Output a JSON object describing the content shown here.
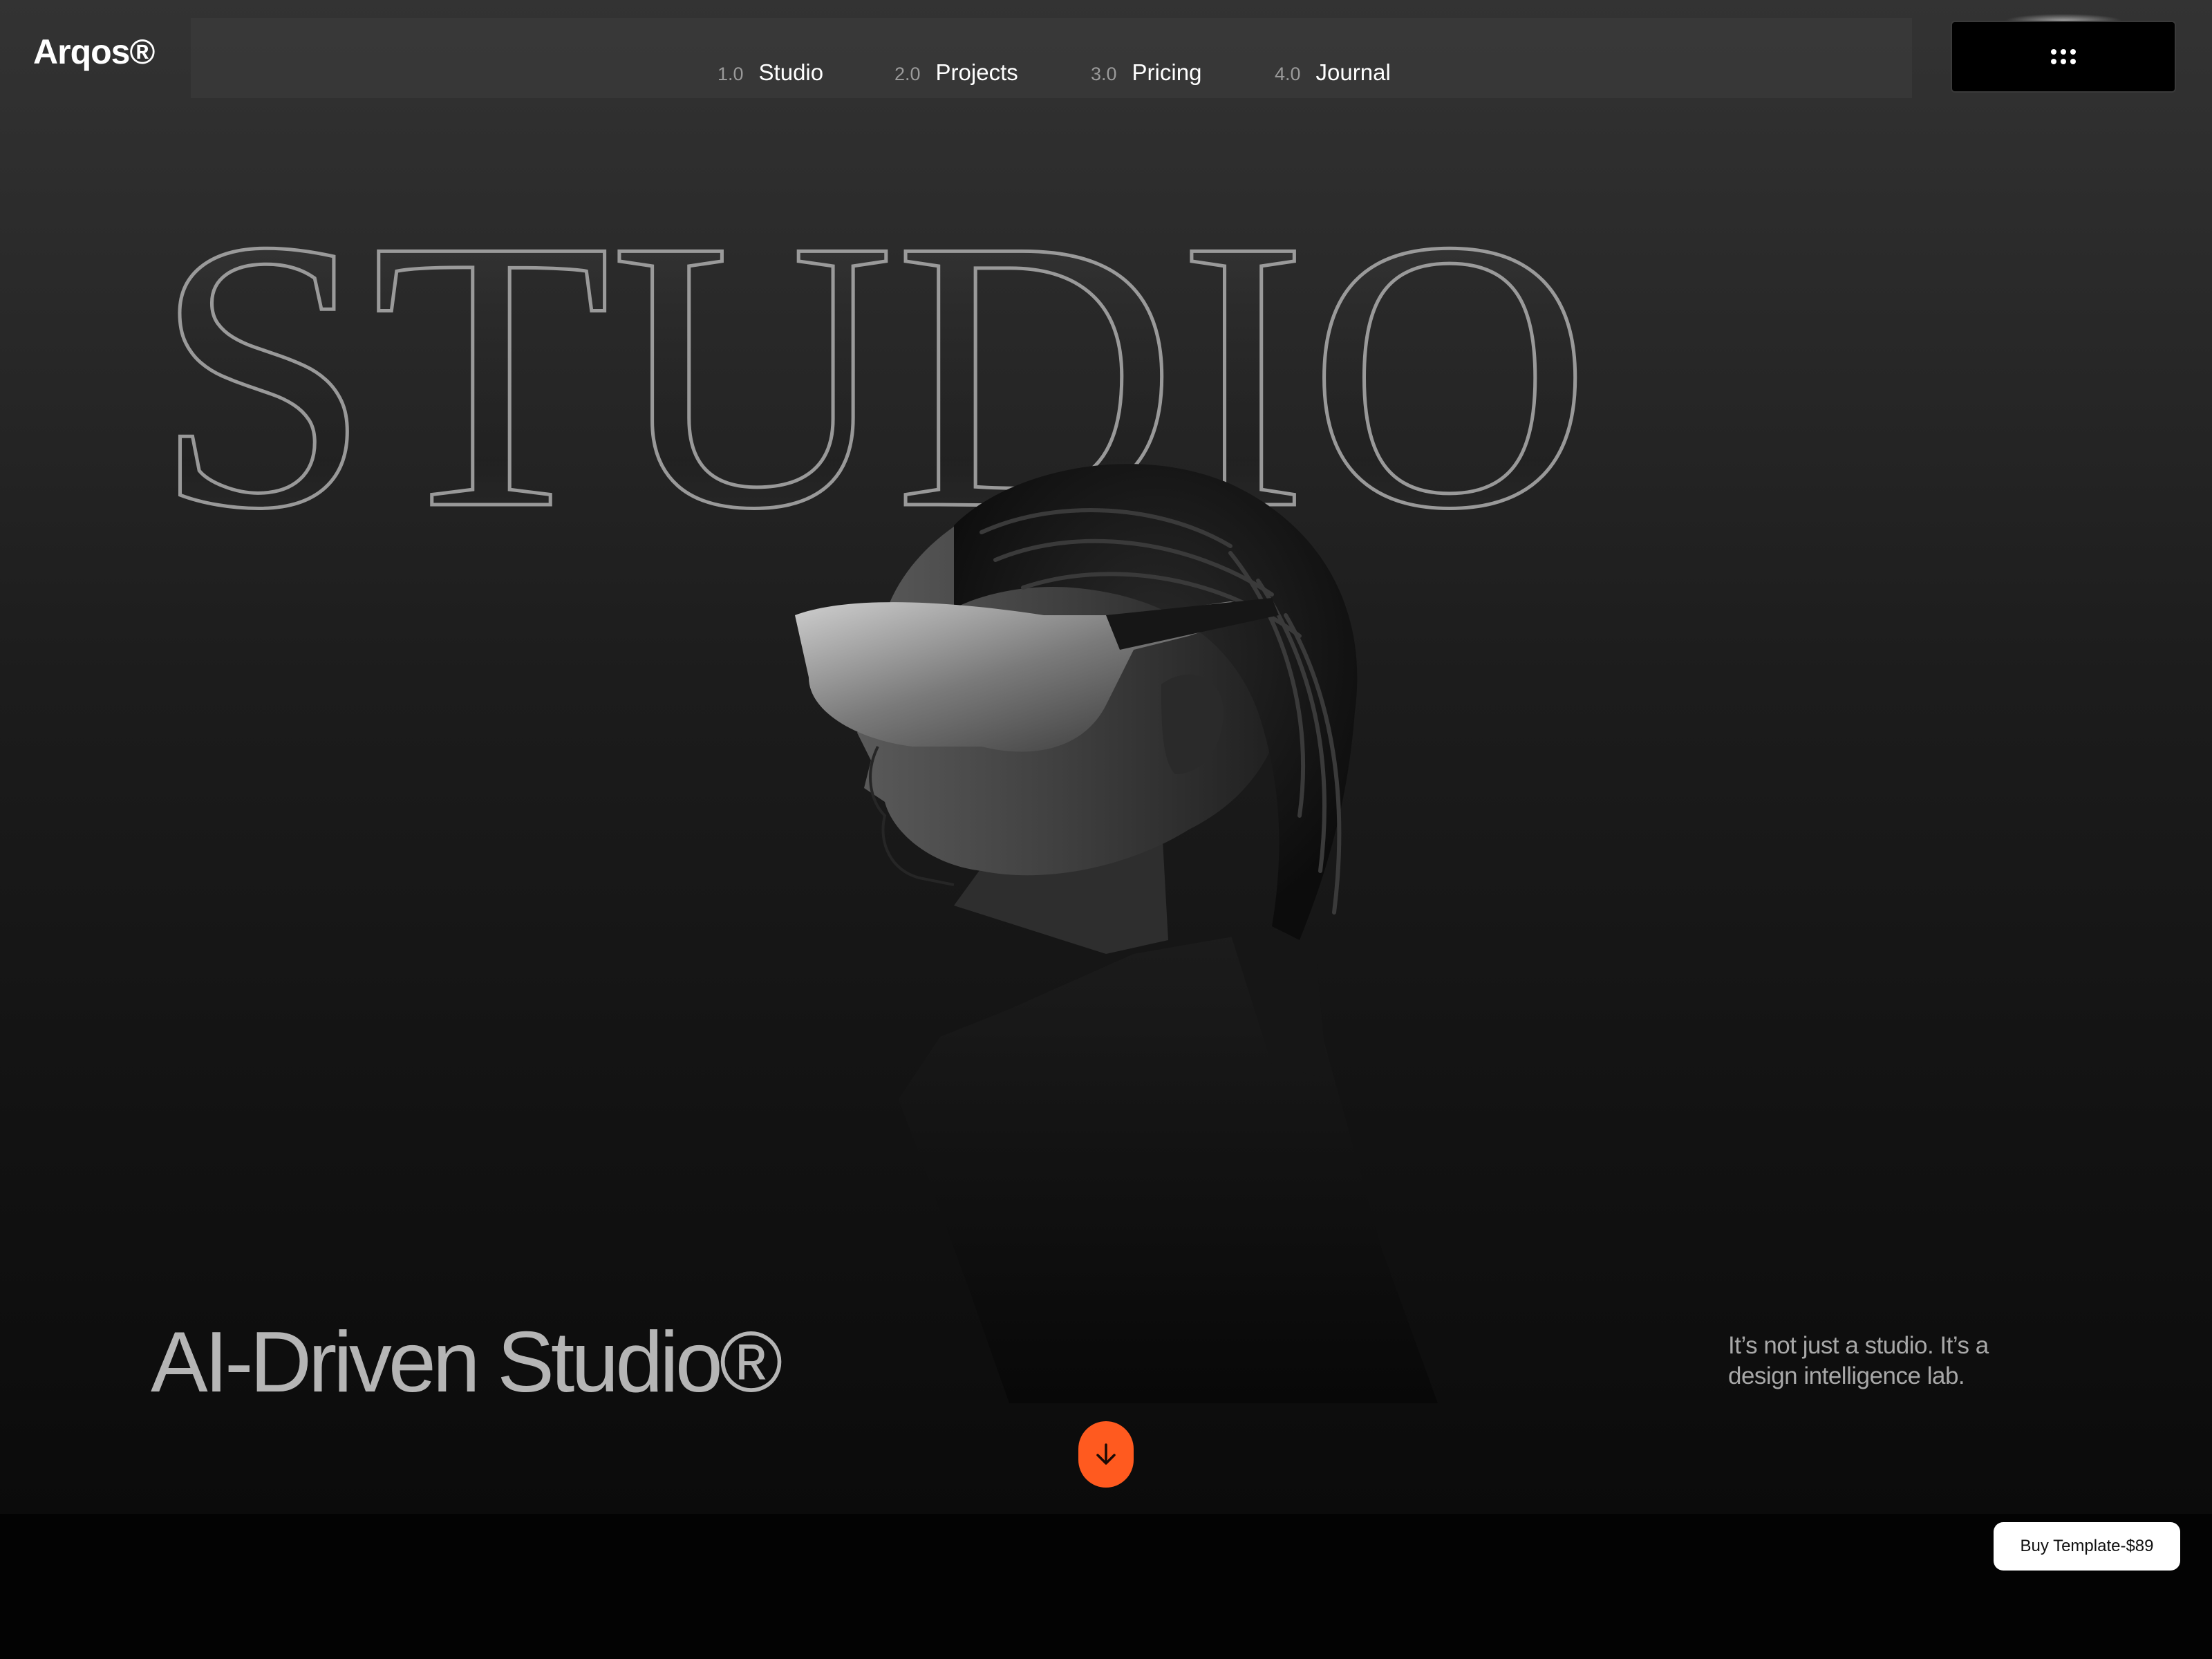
{
  "brand": {
    "name": "Arqos®"
  },
  "nav": {
    "items": [
      {
        "number": "1.0",
        "label": "Studio"
      },
      {
        "number": "2.0",
        "label": "Projects"
      },
      {
        "number": "3.0",
        "label": "Pricing"
      },
      {
        "number": "4.0",
        "label": "Journal"
      }
    ],
    "menu_icon": "dots-grid-icon"
  },
  "hero": {
    "big_title": "STUDIO",
    "heading": "AI-Driven Studio®",
    "tagline": "It’s not just a studio. It’s a design intelligence lab.",
    "scroll_icon": "arrow-down-icon"
  },
  "cta": {
    "buy_label": "Buy Template-$89"
  },
  "colors": {
    "accent": "#ff5a1f",
    "background_top": "#333333",
    "background_bottom": "#030303",
    "text_muted": "#b5b5b5"
  }
}
